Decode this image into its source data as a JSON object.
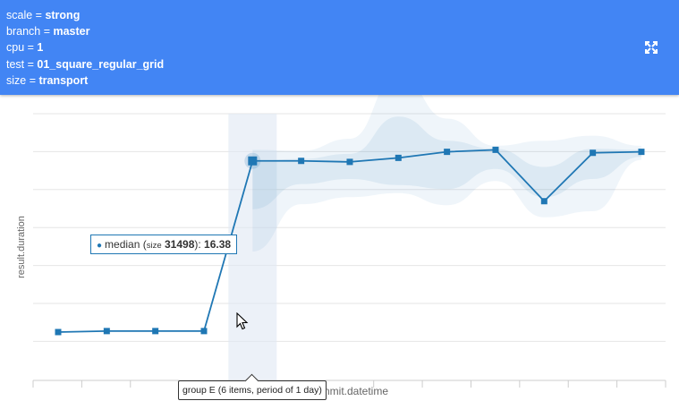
{
  "header": {
    "params": [
      {
        "key": "scale",
        "value": "strong"
      },
      {
        "key": "branch",
        "value": "master"
      },
      {
        "key": "cpu",
        "value": "1"
      },
      {
        "key": "test",
        "value": "01_square_regular_grid"
      },
      {
        "key": "size",
        "value": "transport"
      }
    ],
    "separator": " = ",
    "fullscreen_icon": "fullscreen-expand-icon"
  },
  "chart_data": {
    "type": "line",
    "xlabel": "commit.datetime",
    "ylabel": "result.duration",
    "ylim": [
      14.2,
      16.84
    ],
    "grid": true,
    "series": [
      {
        "values": [
          14.68,
          14.69,
          14.69,
          14.69,
          16.38,
          16.38,
          16.37,
          16.41,
          16.47,
          16.49,
          15.98,
          16.46,
          16.47
        ],
        "band_outer_upper": [
          null,
          null,
          null,
          null,
          16.49,
          16.48,
          16.6,
          17.24,
          16.8,
          16.53,
          16.58,
          16.63,
          16.53
        ],
        "band_outer_lower": [
          null,
          null,
          null,
          null,
          15.48,
          15.95,
          16.02,
          16.06,
          15.94,
          16.18,
          15.82,
          15.88,
          16.39
        ],
        "band_inner_upper": [
          null,
          null,
          null,
          null,
          16.38,
          16.4,
          16.45,
          16.82,
          16.58,
          16.5,
          16.32,
          16.5,
          16.49
        ],
        "band_inner_lower": [
          null,
          null,
          null,
          null,
          15.9,
          16.15,
          16.2,
          16.14,
          16.1,
          16.3,
          16.02,
          16.2,
          16.42
        ]
      }
    ],
    "highlight_index": 4,
    "color": "#1f77b4",
    "tooltip": {
      "series_label": "median",
      "size_label": "size",
      "size_value": "31498",
      "value": "16.38"
    },
    "group_tooltip": "group E (6 items, period of 1 day)"
  },
  "colors": {
    "header": "#4285f4",
    "line": "#1f77b4",
    "grid": "#e6e6e6"
  }
}
